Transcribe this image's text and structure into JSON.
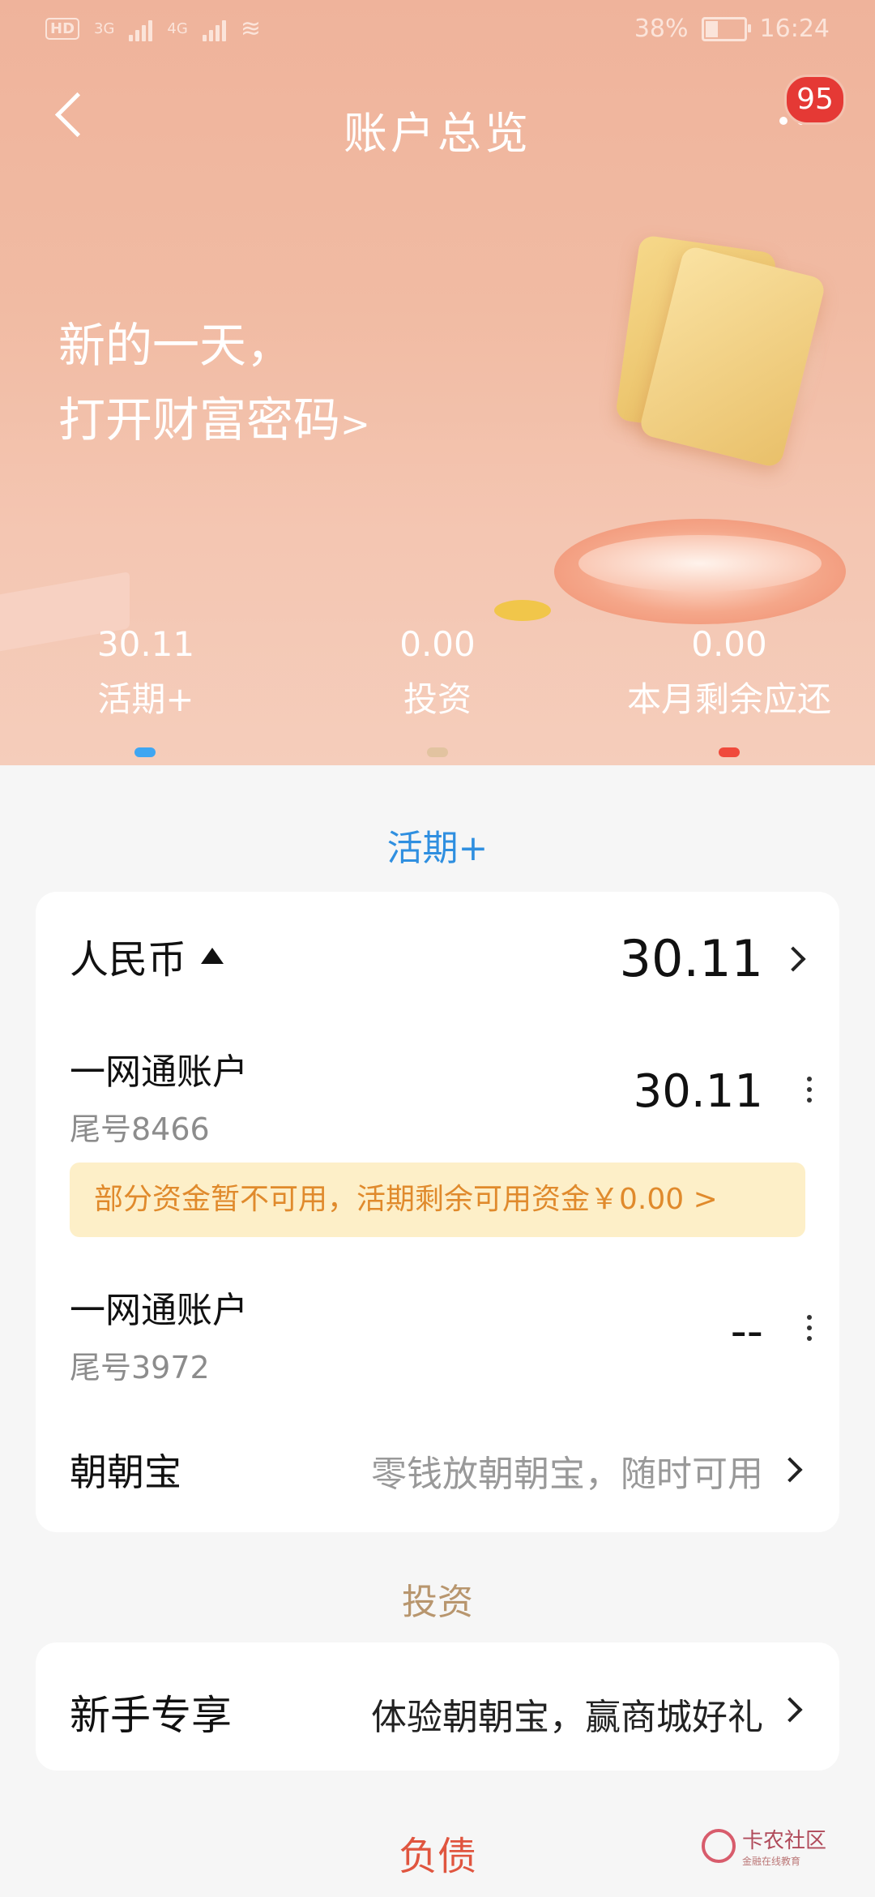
{
  "status_bar": {
    "left_tags": [
      "HD",
      "3G",
      "4G"
    ],
    "battery": "38%",
    "battery_level": 0.38,
    "time": "16:24"
  },
  "header": {
    "title": "账户总览",
    "badge_count": "95"
  },
  "banner": {
    "line1": "新的一天，",
    "line2": "打开财富密码",
    "arrow": ">"
  },
  "summary": [
    {
      "value": "30.11",
      "label": "活期+",
      "indicator_color": "#3fa6f2"
    },
    {
      "value": "0.00",
      "label": "投资",
      "indicator_color": "#e2c3a0"
    },
    {
      "value": "0.00",
      "label": "本月剩余应还",
      "indicator_color": "#f04a3c"
    }
  ],
  "current": {
    "section_title": "活期+",
    "section_color": "#2f8fe0",
    "currency_label": "人民币",
    "currency_total": "30.11",
    "accounts": [
      {
        "name": "一网通账户",
        "tail": "尾号8466",
        "amount": "30.11"
      },
      {
        "name": "一网通账户",
        "tail": "尾号3972",
        "amount": "--"
      }
    ],
    "notice": "部分资金暂不可用，活期剩余可用资金￥0.00 >",
    "zhaozhaobao_label": "朝朝宝",
    "zhaozhaobao_desc": "零钱放朝朝宝，随时可用"
  },
  "invest": {
    "section_title": "投资",
    "section_color": "#b8966e",
    "row_label": "新手专享",
    "row_desc": "体验朝朝宝，赢商城好礼"
  },
  "debt": {
    "section_title": "负债",
    "section_color": "#e0553f"
  },
  "watermark": {
    "title": "卡农社区",
    "subtitle": "金融在线教育"
  }
}
